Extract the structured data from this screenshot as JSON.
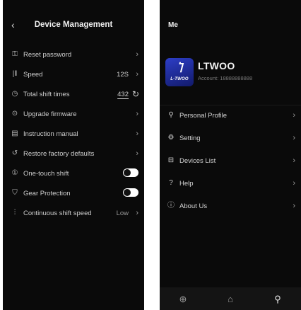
{
  "device_management": {
    "back_glyph": "‹",
    "title": "Device Management",
    "rows": [
      {
        "label": "Reset password",
        "icon": "key-icon",
        "type": "link"
      },
      {
        "label": "Speed",
        "icon": "speed-icon",
        "type": "value",
        "value": "12S"
      },
      {
        "label": "Total shift times",
        "icon": "clock-icon",
        "type": "count",
        "value": "432"
      },
      {
        "label": "Upgrade firmware",
        "icon": "upgrade-icon",
        "type": "link"
      },
      {
        "label": "Instruction manual",
        "icon": "manual-icon",
        "type": "link"
      },
      {
        "label": "Restore factory defaults",
        "icon": "restore-icon",
        "type": "link"
      },
      {
        "label": "One-touch shift",
        "icon": "one-touch-icon",
        "type": "toggle",
        "enabled": false
      },
      {
        "label": "Gear Protection",
        "icon": "shield-icon",
        "type": "toggle",
        "enabled": false
      },
      {
        "label": "Continuous shift speed",
        "icon": "continuous-shift-icon",
        "type": "value",
        "value": "Low"
      }
    ]
  },
  "me": {
    "title": "Me",
    "profile": {
      "name": "LTWOO",
      "account": "Account:  18888888888",
      "logo_text": "L-TWOO"
    },
    "menu": [
      {
        "label": "Personal Profile",
        "icon": "person-icon"
      },
      {
        "label": "Setting",
        "icon": "gear-icon"
      },
      {
        "label": "Devices List",
        "icon": "devices-list-icon"
      },
      {
        "label": "Help",
        "icon": "help-icon"
      },
      {
        "label": "About Us",
        "icon": "info-icon"
      }
    ],
    "tabs": [
      {
        "icon": "globe-icon",
        "active": false
      },
      {
        "icon": "home-icon",
        "active": false
      },
      {
        "icon": "person-icon",
        "active": true
      }
    ]
  },
  "colors": {
    "background": "#0a0a0a",
    "text": "#cfcfcf",
    "muted": "#9a9a9a",
    "brand_blue": "#2d3ec7",
    "toggle": "#ffffff"
  }
}
